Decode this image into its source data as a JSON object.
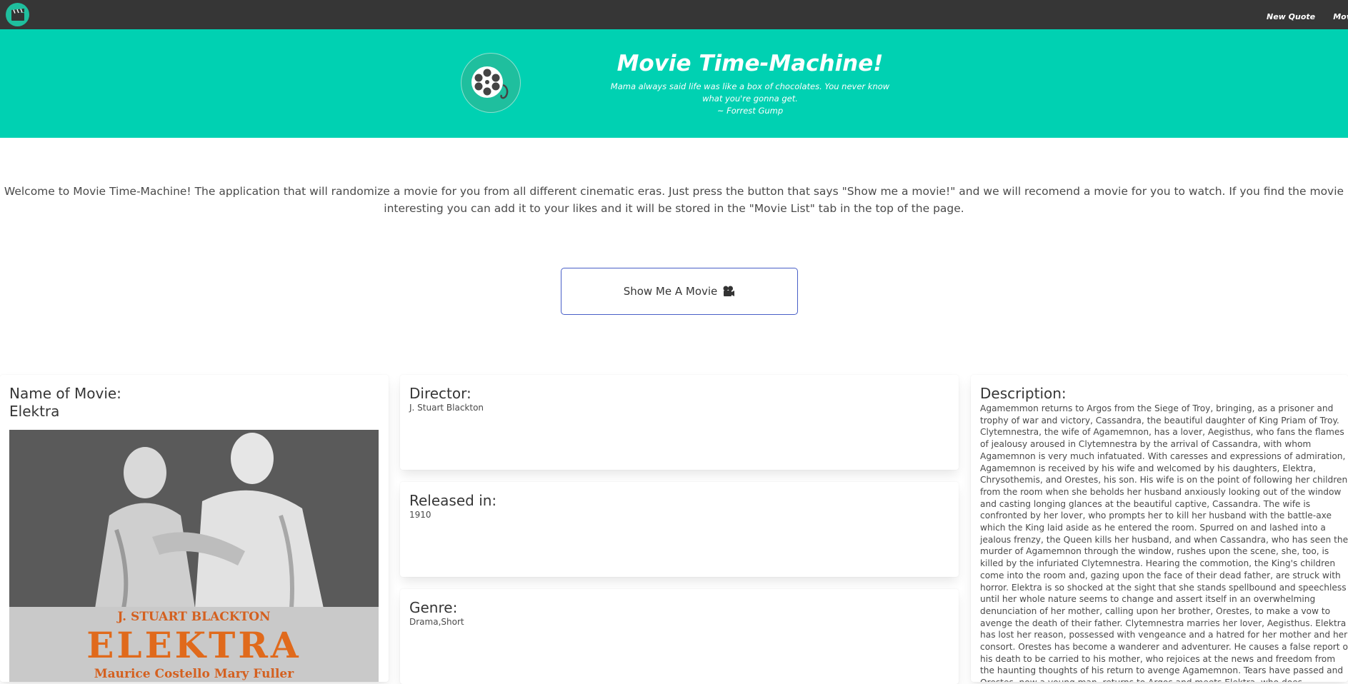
{
  "nav": {
    "logo_icon": "clapperboard-icon",
    "links": [
      "New Quote",
      "Movie List"
    ]
  },
  "hero": {
    "logo_icon": "film-reel-icon",
    "title": "Movie Time-Machine!",
    "quote": "Mama always said life was like a box of chocolates. You never know what you're gonna get.",
    "attribution": "~ Forrest Gump"
  },
  "intro": {
    "text": "Welcome to Movie Time-Machine! The application that will randomize a movie for you from all different cinematic eras. Just press the button that says \"Show me a movie!\" and we will recomend a movie for you to watch. If you find the movie interesting you can add it to your likes and it will be stored in the \"Movie List\" tab in the top of the page."
  },
  "show_button": {
    "label": "Show Me A Movie",
    "icon": "movie-camera-icon"
  },
  "movie": {
    "name_heading": "Name of Movie:",
    "name": "Elektra",
    "poster": {
      "director_line": "J. STUART BLACKTON",
      "title_line": "ELEKTRA",
      "cast_line": "Maurice Costello Mary Fuller"
    },
    "director_heading": "Director:",
    "director": "J. Stuart Blackton",
    "released_heading": "Released in:",
    "released": "1910",
    "genre_heading": "Genre:",
    "genre": "Drama,Short",
    "description_heading": "Description:",
    "description": "Agamemmon returns to Argos from the Siege of Troy, bringing, as a prisoner and trophy of war and victory, Cassandra, the beautiful daughter of King Priam of Troy. Clytemnestra, the wife of Agamemnon, has a lover, Aegisthus, who fans the flames of jealousy aroused in Clytemnestra by the arrival of Cassandra, with whom Agamemnon is very much infatuated. With caresses and expressions of admiration, Agamemnon is received by his wife and welcomed by his daughters, Elektra, Chrysothemis, and Orestes, his son. His wife is on the point of following her children from the room when she beholds her husband anxiously looking out of the window and casting longing glances at the beautiful captive, Cassandra. The wife is confronted by her lover, who prompts her to kill her husband with the battle-axe which the King laid aside as he entered the room. Spurred on and lashed into a jealous frenzy, the Queen kills her husband, and when Cassandra, who has seen the murder of Agamemnon through the window, rushes upon the scene, she, too, is killed by the infuriated Clytemnestra. Hearing the commotion, the King's children come into the room and, gazing upon the face of their dead father, are struck with horror. Elektra is so shocked at the sight that she stands spellbound and speechless until her whole nature seems to change and assert itself in an overwhelming denunciation of her mother, calling upon her brother, Orestes, to make a vow to avenge the death of their father. Clytemnestra marries her lover, Aegisthus. Elektra has lost her reason, possessed with vengeance and a hatred for her mother and her consort. Orestes has become a wanderer and adventurer. He causes a false report of his death to be carried to his mother, who rejoices at the news and freedom from the haunting thoughts of his return to avenge Agamemnon. Tears have passed and Orestes, now a young man, returns to Argos and meets Elektra, who does"
  }
}
